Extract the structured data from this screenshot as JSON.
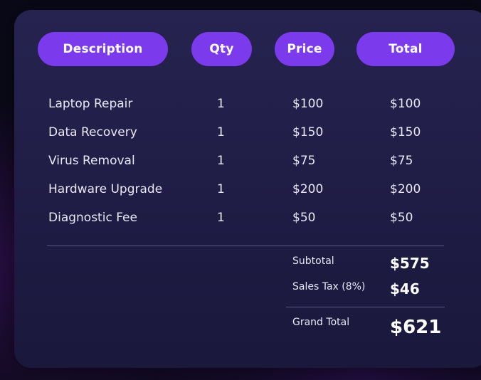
{
  "headers": {
    "description": "Description",
    "qty": "Qty",
    "price": "Price",
    "total": "Total"
  },
  "rows": [
    {
      "description": "Laptop Repair",
      "qty": "1",
      "price": "$100",
      "total": "$100"
    },
    {
      "description": "Data Recovery",
      "qty": "1",
      "price": "$150",
      "total": "$150"
    },
    {
      "description": "Virus Removal",
      "qty": "1",
      "price": "$75",
      "total": "$75"
    },
    {
      "description": "Hardware Upgrade",
      "qty": "1",
      "price": "$200",
      "total": "$200"
    },
    {
      "description": "Diagnostic Fee",
      "qty": "1",
      "price": "$50",
      "total": "$50"
    }
  ],
  "summary": {
    "subtotal_label": "Subtotal",
    "subtotal_value": "$575",
    "tax_label": "Sales Tax (8%)",
    "tax_value": "$46",
    "grand_total_label": "Grand Total",
    "grand_total_value": "$621"
  },
  "colors": {
    "accent": "#7c3aed",
    "card": "#232050",
    "background": "#0a0918"
  }
}
